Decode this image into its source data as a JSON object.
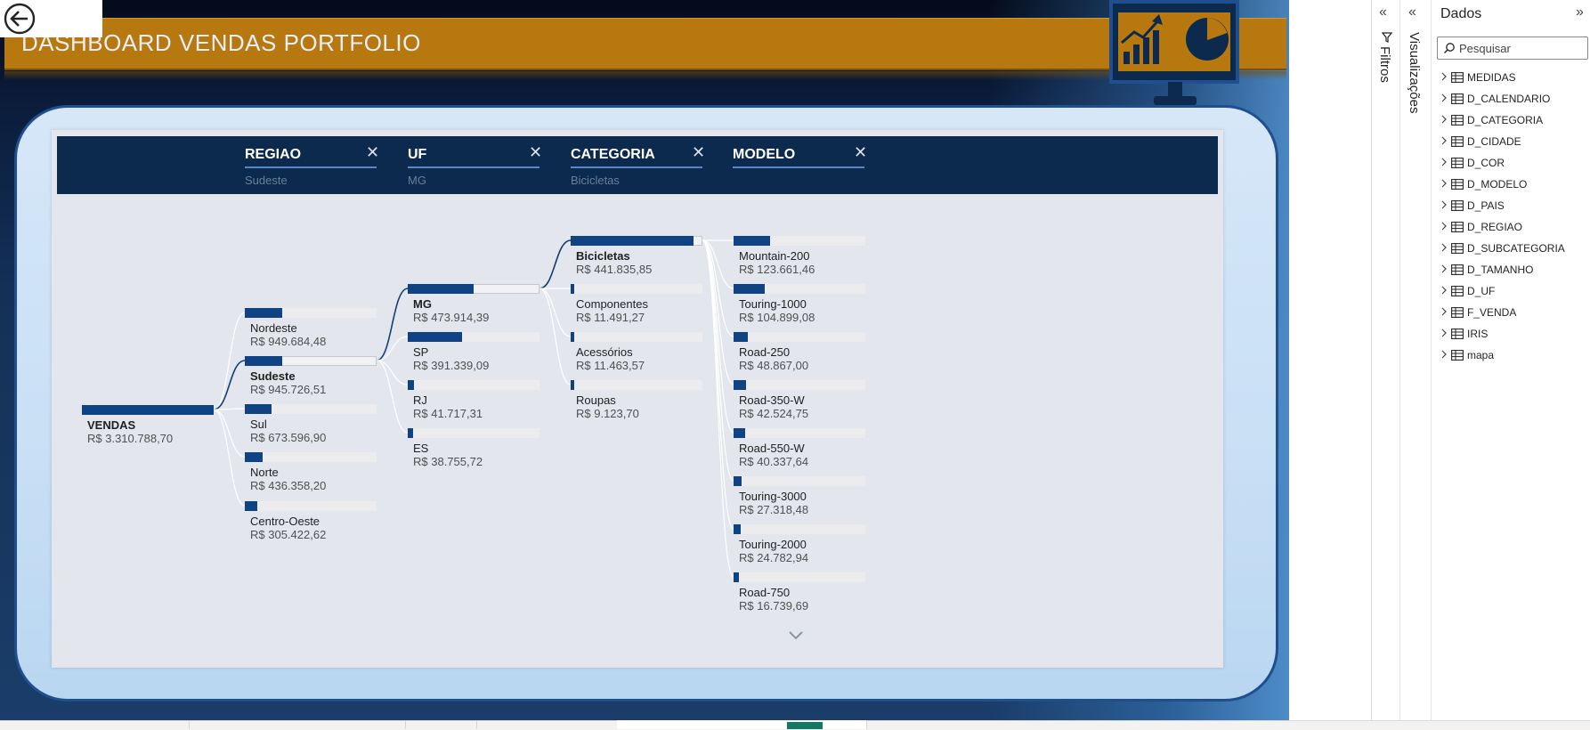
{
  "report": {
    "title": "DASHBOARD VENDAS PORTFOLIO"
  },
  "decomposition_tree": {
    "levels": [
      {
        "title": "REGIAO",
        "selected": "Sudeste"
      },
      {
        "title": "UF",
        "selected": "MG"
      },
      {
        "title": "CATEGORIA",
        "selected": "Bicicletas"
      },
      {
        "title": "MODELO",
        "selected": ""
      }
    ],
    "root": {
      "label": "VENDAS",
      "value": "R$ 3.310.788,70",
      "fraction": 1.0
    },
    "regiao": [
      {
        "label": "Nordeste",
        "value": "R$ 949.684,48",
        "fraction": 0.287
      },
      {
        "label": "Sudeste",
        "value": "R$ 945.726,51",
        "fraction": 0.286
      },
      {
        "label": "Sul",
        "value": "R$ 673.596,90",
        "fraction": 0.203
      },
      {
        "label": "Norte",
        "value": "R$ 436.358,20",
        "fraction": 0.132
      },
      {
        "label": "Centro-Oeste",
        "value": "R$ 305.422,62",
        "fraction": 0.092
      }
    ],
    "uf": [
      {
        "label": "MG",
        "value": "R$ 473.914,39",
        "fraction": 0.501
      },
      {
        "label": "SP",
        "value": "R$ 391.339,09",
        "fraction": 0.414
      },
      {
        "label": "RJ",
        "value": "R$ 41.717,31",
        "fraction": 0.044
      },
      {
        "label": "ES",
        "value": "R$ 38.755,72",
        "fraction": 0.041
      }
    ],
    "categoria": [
      {
        "label": "Bicicletas",
        "value": "R$ 441.835,85",
        "fraction": 0.932
      },
      {
        "label": "Componentes",
        "value": "R$ 11.491,27",
        "fraction": 0.024
      },
      {
        "label": "Acessórios",
        "value": "R$ 11.463,57",
        "fraction": 0.024
      },
      {
        "label": "Roupas",
        "value": "R$ 9.123,70",
        "fraction": 0.019
      }
    ],
    "modelo": [
      {
        "label": "Mountain-200",
        "value": "R$ 123.661,46",
        "fraction": 0.28
      },
      {
        "label": "Touring-1000",
        "value": "R$ 104.899,08",
        "fraction": 0.237
      },
      {
        "label": "Road-250",
        "value": "R$ 48.867,00",
        "fraction": 0.111
      },
      {
        "label": "Road-350-W",
        "value": "R$ 42.524,75",
        "fraction": 0.096
      },
      {
        "label": "Road-550-W",
        "value": "R$ 40.337,64",
        "fraction": 0.091
      },
      {
        "label": "Touring-3000",
        "value": "R$ 27.318,48",
        "fraction": 0.062
      },
      {
        "label": "Touring-2000",
        "value": "R$ 24.782,94",
        "fraction": 0.056
      },
      {
        "label": "Road-750",
        "value": "R$ 16.739,69",
        "fraction": 0.038
      }
    ]
  },
  "panes": {
    "filters_label": "Filtros",
    "visualizations_label": "Visualizações",
    "data_title": "Dados",
    "search_placeholder": "Pesquisar",
    "fields": [
      {
        "name": "MEDIDAS",
        "icon": "measure-table-icon"
      },
      {
        "name": "D_CALENDARIO",
        "icon": "calendar-table-icon"
      },
      {
        "name": "D_CATEGORIA",
        "icon": "table-icon"
      },
      {
        "name": "D_CIDADE",
        "icon": "table-icon"
      },
      {
        "name": "D_COR",
        "icon": "table-icon"
      },
      {
        "name": "D_MODELO",
        "icon": "table-icon"
      },
      {
        "name": "D_PAIS",
        "icon": "table-icon"
      },
      {
        "name": "D_REGIAO",
        "icon": "table-icon"
      },
      {
        "name": "D_SUBCATEGORIA",
        "icon": "table-icon"
      },
      {
        "name": "D_TAMANHO",
        "icon": "table-icon"
      },
      {
        "name": "D_UF",
        "icon": "table-icon"
      },
      {
        "name": "F_VENDA",
        "icon": "table-icon"
      },
      {
        "name": "IRIS",
        "icon": "table-icon"
      },
      {
        "name": "mapa",
        "icon": "table-icon"
      }
    ]
  },
  "colors": {
    "header": "#b7790f",
    "bar": "#0f4383",
    "level_band": "#0b2a4d",
    "tab_accent": "#117865"
  }
}
